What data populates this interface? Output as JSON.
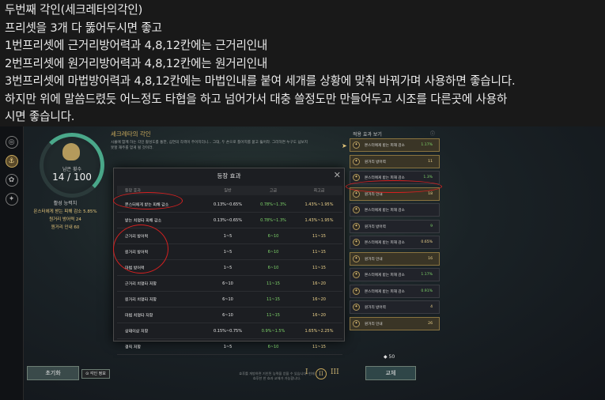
{
  "post": {
    "lines": [
      "두번째 각인(세크레타의각인)",
      "프리셋을 3개 다 뚫어두시면 좋고",
      "1번프리셋에 근거리방어력과 4,8,12칸에는 근거리인내",
      "2번프리셋에 원거리방어력과 4,8,12칸에는 원거리인내",
      "3번프리셋에 마법방어력과 4,8,12칸에는 마법인내를 붙여 세개를 상황에 맞춰 바꿔가며 사용하면 좋습니다.",
      "하지만 위에 말씀드렸듯 어느정도 타협을 하고 넘어가서 대충 쓸정도만 만들어두고 시조를 다른곳에 사용하",
      "시면 좋습니다."
    ]
  },
  "game": {
    "side_icons": [
      "◎",
      "⚓",
      "✿",
      "✦"
    ],
    "ring": {
      "caption": "남은 횟수",
      "count": "14 / 100"
    },
    "left_title": "활성 능력치",
    "left_stats": [
      "몬스터에게 받는 피해 감소 5.85%",
      "원거리 방어력 24",
      "원거리 인내 60"
    ],
    "init_button": "초기화",
    "effect_toggle": "⊙ 각인 정보",
    "section_title": "세크레타의 각인",
    "section_desc": "시뮬에 함께 하는 각인 활성도를 통한, 심연의 각격이 주어지더니... 그대, 두 손으로 틀어지를 묻고 뚫어라. 그리하면 누구도 넘보지 못할 재주를 얻게 될 것이라.",
    "modal": {
      "title": "등장 효과",
      "close": "✕",
      "headers": [
        "등장 효과",
        "일반",
        "고급",
        "최고급"
      ],
      "rows": [
        [
          "몬스터에게 받는 피해 감소",
          "0.13%~0.65%",
          "0.78%~1.3%",
          "1.43%~1.95%"
        ],
        [
          "받는 치명타 피해 감소",
          "0.13%~0.65%",
          "0.78%~1.3%",
          "1.43%~1.95%"
        ],
        [
          "근거리 방어력",
          "1~5",
          "6~10",
          "11~15"
        ],
        [
          "원거리 방어력",
          "1~5",
          "6~10",
          "11~15"
        ],
        [
          "마법 방어력",
          "1~5",
          "6~10",
          "11~15"
        ],
        [
          "근거리 치명타 저항",
          "6~10",
          "11~15",
          "16~20"
        ],
        [
          "원거리 치명타 저항",
          "6~10",
          "11~15",
          "16~20"
        ],
        [
          "마법 치명타 저항",
          "6~10",
          "11~15",
          "16~20"
        ],
        [
          "상태이상 저항",
          "0.15%~0.75%",
          "0.9%~1.5%",
          "1.65%~2.25%"
        ],
        [
          "경직 저항",
          "1~5",
          "6~10",
          "11~15"
        ]
      ]
    },
    "right": {
      "title": "적용 효과 보기",
      "help": "ⓘ",
      "items": [
        {
          "name": "몬스터에게 받는 피해 감소",
          "value": "1.17%",
          "hi": true,
          "green": true
        },
        {
          "name": "원거리 방어력",
          "value": "11",
          "hi": true,
          "green": false
        },
        {
          "name": "몬스터에게 받는 피해 감소",
          "value": "1.3%",
          "hi": false,
          "green": true
        },
        {
          "name": "원거리 인내",
          "value": "18",
          "hi": true,
          "green": false
        },
        {
          "name": "몬스터에게 받는 피해 감소",
          "value": "",
          "hi": false,
          "green": false
        },
        {
          "name": "원거리 방어력",
          "value": "9",
          "hi": false,
          "green": true
        },
        {
          "name": "몬스터에게 받는 피해 감소",
          "value": "0.65%",
          "hi": false,
          "green": false
        },
        {
          "name": "원거리 인내",
          "value": "16",
          "hi": true,
          "green": false
        },
        {
          "name": "몬스터에게 받는 피해 감소",
          "value": "1.17%",
          "hi": false,
          "green": true
        },
        {
          "name": "몬스터에게 받는 피해 감소",
          "value": "0.91%",
          "hi": false,
          "green": true
        },
        {
          "name": "원거리 방어력",
          "value": "4",
          "hi": false,
          "green": false
        },
        {
          "name": "원거리 인내",
          "value": "26",
          "hi": true,
          "green": false
        }
      ]
    },
    "bottom_info": "효후를 개방하면 기인된 능력을 얻을 수 있습니다. 현재 효후한 한 효과 교체가 가능합니다.",
    "roman": [
      "I",
      "II",
      "III"
    ],
    "coin": "◆ 50",
    "swap_button": "교체"
  },
  "colors": {
    "accent_gold": "#c9a95c",
    "annotation_red": "#d62020",
    "green_value": "#7fd66a"
  }
}
